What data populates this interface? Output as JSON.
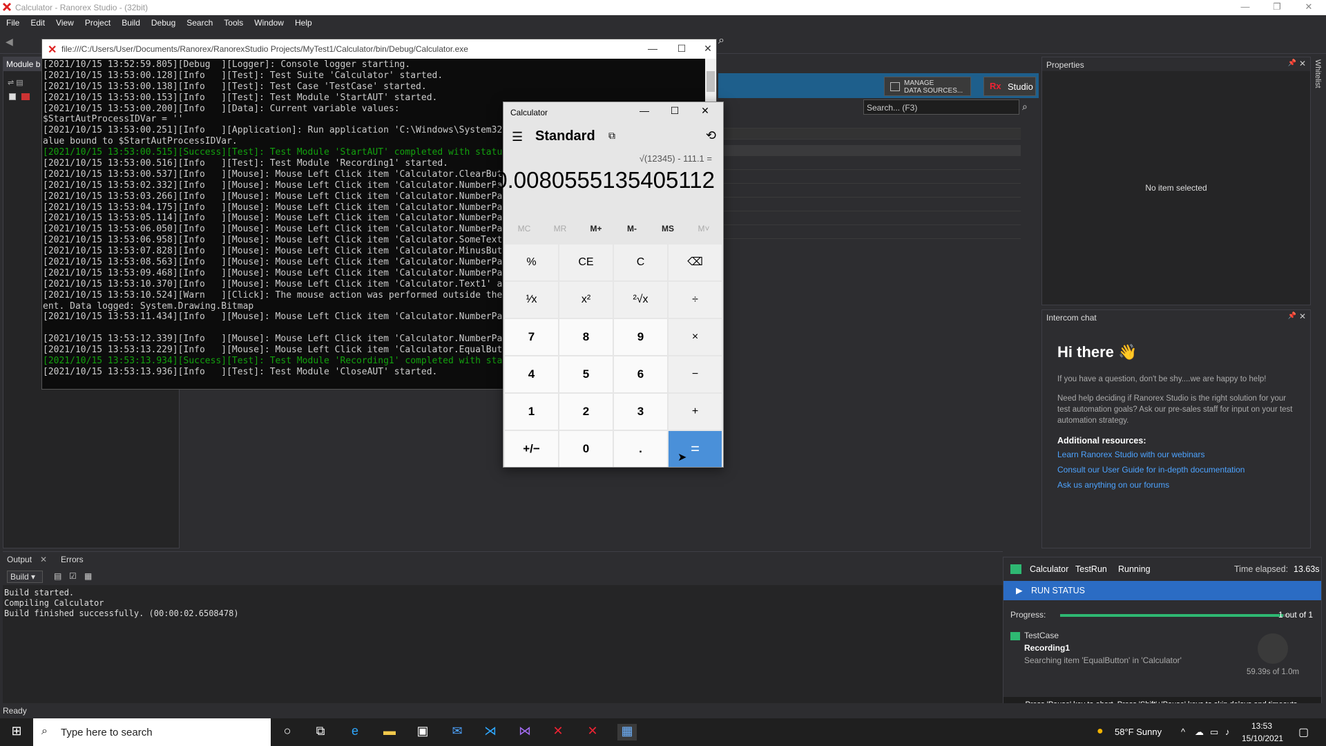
{
  "window": {
    "title": "Calculator - Ranorex Studio - (32bit)"
  },
  "menu": [
    "File",
    "Edit",
    "View",
    "Project",
    "Build",
    "Debug",
    "Search",
    "Tools",
    "Window",
    "Help"
  ],
  "left_panel": {
    "tab_label": "Module b"
  },
  "center": {
    "manage_label_1": "MANAGE",
    "manage_label_2": "DATA SOURCES...",
    "studio_label": "Studio",
    "search_placeholder": "Search... (F3)"
  },
  "properties": {
    "title": "Properties",
    "empty_text": "No item selected"
  },
  "intercom": {
    "title": "Intercom chat",
    "greeting": "Hi there 👋",
    "p1": "If you have a question, don't be shy....we are happy to help!",
    "p2": "Need help deciding if Ranorex Studio is the right solution for your test automation goals? Ask our pre-sales staff for input on your test automation strategy.",
    "resources_title": "Additional resources:",
    "links": [
      "Learn Ranorex Studio with our webinars",
      "Consult our User Guide for in-depth documentation",
      "Ask us anything on our forums"
    ]
  },
  "edge_strip_label": "Whitelist",
  "console": {
    "path": "file:///C:/Users/User/Documents/Ranorex/RanorexStudio Projects/MyTest1/Calculator/bin/Debug/Calculator.exe",
    "lines": [
      {
        "text": "[2021/10/15 13:52:59.805][Debug  ][Logger]: Console logger starting.",
        "ok": false
      },
      {
        "text": "[2021/10/15 13:53:00.128][Info   ][Test]: Test Suite 'Calculator' started.",
        "ok": false
      },
      {
        "text": "[2021/10/15 13:53:00.138][Info   ][Test]: Test Case 'TestCase' started.",
        "ok": false
      },
      {
        "text": "[2021/10/15 13:53:00.153][Info   ][Test]: Test Module 'StartAUT' started.",
        "ok": false
      },
      {
        "text": "[2021/10/15 13:53:00.200][Info   ][Data]: Current variable values:",
        "ok": false
      },
      {
        "text": "$StartAutProcessIDVar = ''",
        "ok": false
      },
      {
        "text": "[2021/10/15 13:53:00.251][Info   ][Application]: Run application 'C:\\Windows\\System32\\calc.exe' with arguments '' in 'C:\\Windows\\System32'. Return v",
        "ok": false
      },
      {
        "text": "alue bound to $StartAutProcessIDVar.",
        "ok": false
      },
      {
        "text": "[2021/10/15 13:53:00.515][Success][Test]: Test Module 'StartAUT' completed with status 'Success'.",
        "ok": true
      },
      {
        "text": "[2021/10/15 13:53:00.516][Info   ][Test]: Test Module 'Recording1' started.",
        "ok": false
      },
      {
        "text": "[2021/10/15 13:53:00.537][Info   ][Mouse]: Mouse Left Click item 'Calculator.ClearButton' at Center.",
        "ok": false
      },
      {
        "text": "[2021/10/15 13:53:02.332][Info   ][Mouse]: Mouse Left Click item 'Calculator.NumberPad.Num1Button' at Center.",
        "ok": false
      },
      {
        "text": "[2021/10/15 13:53:03.266][Info   ][Mouse]: Mouse Left Click item 'Calculator.NumberPad.Num2Button' at Center.",
        "ok": false
      },
      {
        "text": "[2021/10/15 13:53:04.175][Info   ][Mouse]: Mouse Left Click item 'Calculator.NumberPad.Num3Button' at Center.",
        "ok": false
      },
      {
        "text": "[2021/10/15 13:53:05.114][Info   ][Mouse]: Mouse Left Click item 'Calculator.NumberPad.Num4Button' at Center.",
        "ok": false
      },
      {
        "text": "[2021/10/15 13:53:06.050][Info   ][Mouse]: Mouse Left Click item 'Calculator.NumberPad.Num5Button' at Center.",
        "ok": false
      },
      {
        "text": "[2021/10/15 13:53:06.958][Info   ][Mouse]: Mouse Left Click item 'Calculator.SomeText' at Center.",
        "ok": false
      },
      {
        "text": "[2021/10/15 13:53:07.828][Info   ][Mouse]: Mouse Left Click item 'Calculator.MinusButton' at Center.",
        "ok": false
      },
      {
        "text": "[2021/10/15 13:53:08.563][Info   ][Mouse]: Mouse Left Click item 'Calculator.NumberPad.Num1Button' at Center.",
        "ok": false
      },
      {
        "text": "[2021/10/15 13:53:09.468][Info   ][Mouse]: Mouse Left Click item 'Calculator.NumberPad.Num1Button' at Center.",
        "ok": false
      },
      {
        "text": "[2021/10/15 13:53:10.370][Info   ][Mouse]: Mouse Left Click item 'Calculator.Text1' at Center.",
        "ok": false
      },
      {
        "text": "[2021/10/15 13:53:10.524][Warn   ][Click]: The mouse action was performed outside the element's visible area. A screenshot of the elem",
        "ok": false
      },
      {
        "text": "ent. Data logged: System.Drawing.Bitmap",
        "ok": false
      },
      {
        "text": "[2021/10/15 13:53:11.434][Info   ][Mouse]: Mouse Left Click item 'Calculator.NumberPad.Num1Button' at Center.",
        "ok": false
      },
      {
        "text": "",
        "ok": false
      },
      {
        "text": "[2021/10/15 13:53:12.339][Info   ][Mouse]: Mouse Left Click item 'Calculator.NumberPad.Num1Button' at Center.",
        "ok": false
      },
      {
        "text": "[2021/10/15 13:53:13.229][Info   ][Mouse]: Mouse Left Click item 'Calculator.EqualButton' at Center.",
        "ok": false
      },
      {
        "text": "[2021/10/15 13:53:13.934][Success][Test]: Test Module 'Recording1' completed with status 'Success'.",
        "ok": true
      },
      {
        "text": "[2021/10/15 13:53:13.936][Info   ][Test]: Test Module 'CloseAUT' started.",
        "ok": false
      }
    ]
  },
  "calculator": {
    "title": "Calculator",
    "mode": "Standard",
    "expression": "√(12345) - 111.1 =",
    "result": "0.0080555135405112",
    "memory": [
      {
        "label": "MC",
        "enabled": false
      },
      {
        "label": "MR",
        "enabled": false
      },
      {
        "label": "M+",
        "enabled": true
      },
      {
        "label": "M-",
        "enabled": true
      },
      {
        "label": "MS",
        "enabled": true
      },
      {
        "label": "M˅",
        "enabled": false
      }
    ],
    "keys": [
      [
        "%",
        "CE",
        "C",
        "⌫"
      ],
      [
        "¹⁄x",
        "x²",
        "²√x",
        "÷"
      ],
      [
        "7",
        "8",
        "9",
        "×"
      ],
      [
        "4",
        "5",
        "6",
        "−"
      ],
      [
        "1",
        "2",
        "3",
        "+"
      ],
      [
        "+/−",
        "0",
        ".",
        "="
      ]
    ]
  },
  "output": {
    "tabs": [
      "Output",
      "Errors"
    ],
    "source": "Build",
    "lines": [
      "Build started.",
      "Compiling Calculator",
      "Build finished successfully. (00:00:02.6508478)"
    ]
  },
  "run_status": {
    "suite": "Calculator",
    "run": "TestRun",
    "state": "Running",
    "elapsed_label": "Time elapsed:",
    "elapsed": "13.63s",
    "bar_label": "RUN STATUS",
    "progress_label": "Progress:",
    "progress_fraction": 0.98,
    "progress_text": "1 out of 1",
    "test_case": "TestCase",
    "module": "Recording1",
    "activity": "Searching item 'EqualButton' in 'Calculator'",
    "timeout": "59.39s of 1.0m",
    "footer": "Press 'Pause' key to abort. Press 'Shift'+'Pause' keys to skip delays and timeouts."
  },
  "status_text": "Ready",
  "taskbar": {
    "search_placeholder": "Type here to search",
    "weather": "58°F  Sunny",
    "time": "13:53",
    "date": "15/10/2021"
  }
}
